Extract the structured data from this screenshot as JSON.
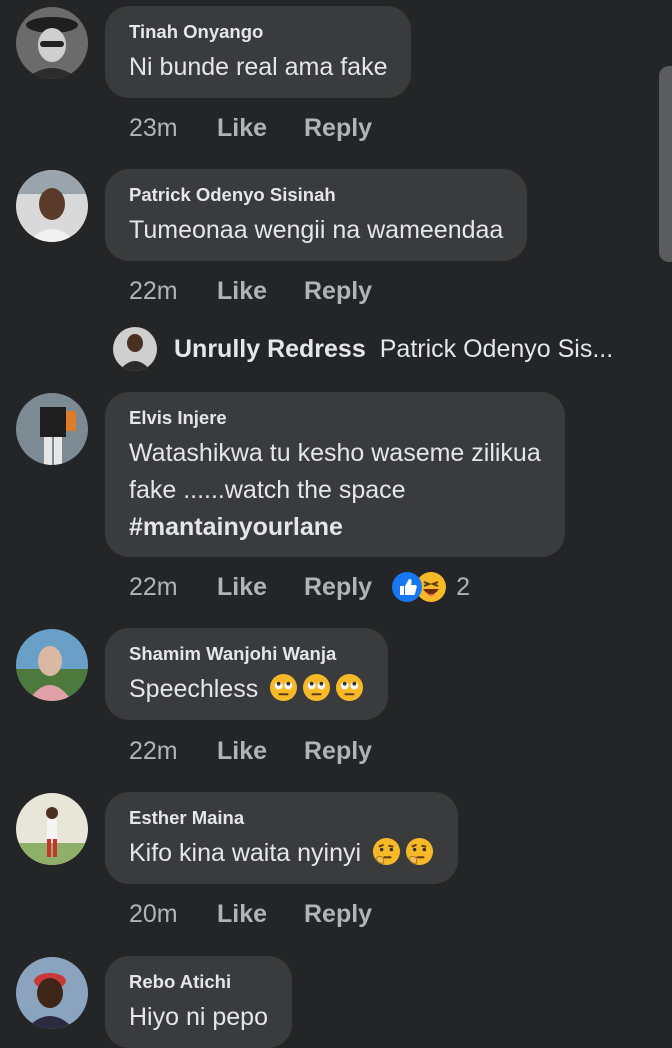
{
  "comments": [
    {
      "author": "Tinah Onyango",
      "text": "Ni bunde real ama fake",
      "time": "23m",
      "like": "Like",
      "reply": "Reply"
    },
    {
      "author": "Patrick Odenyo Sisinah",
      "text": "Tumeonaa wengii na wameendaa",
      "time": "22m",
      "like": "Like",
      "reply": "Reply"
    },
    {
      "author": "Elvis Injere",
      "text_line1": "Watashikwa tu kesho waseme zilikua",
      "text_line2": "fake ......watch the space",
      "hashtag": "#mantainyourlane",
      "time": "22m",
      "like": "Like",
      "reply": "Reply",
      "reaction_count": "2"
    },
    {
      "author": "Shamim Wanjohi Wanja",
      "text": "Speechless",
      "time": "22m",
      "like": "Like",
      "reply": "Reply"
    },
    {
      "author": "Esther Maina",
      "text": "Kifo kina waita nyinyi",
      "time": "20m",
      "like": "Like",
      "reply": "Reply"
    },
    {
      "author": "Rebo Atichi",
      "text": "Hiyo ni pepo"
    }
  ],
  "reply_preview": {
    "author": "Unrully Redress",
    "snippet": "Patrick Odenyo Sis..."
  },
  "colors": {
    "background": "#242526",
    "bubble": "#3a3b3c",
    "text": "#e4e6eb",
    "muted": "#b0b3b8",
    "like_blue": "#1877f2",
    "haha_yellow": "#f7b928"
  }
}
